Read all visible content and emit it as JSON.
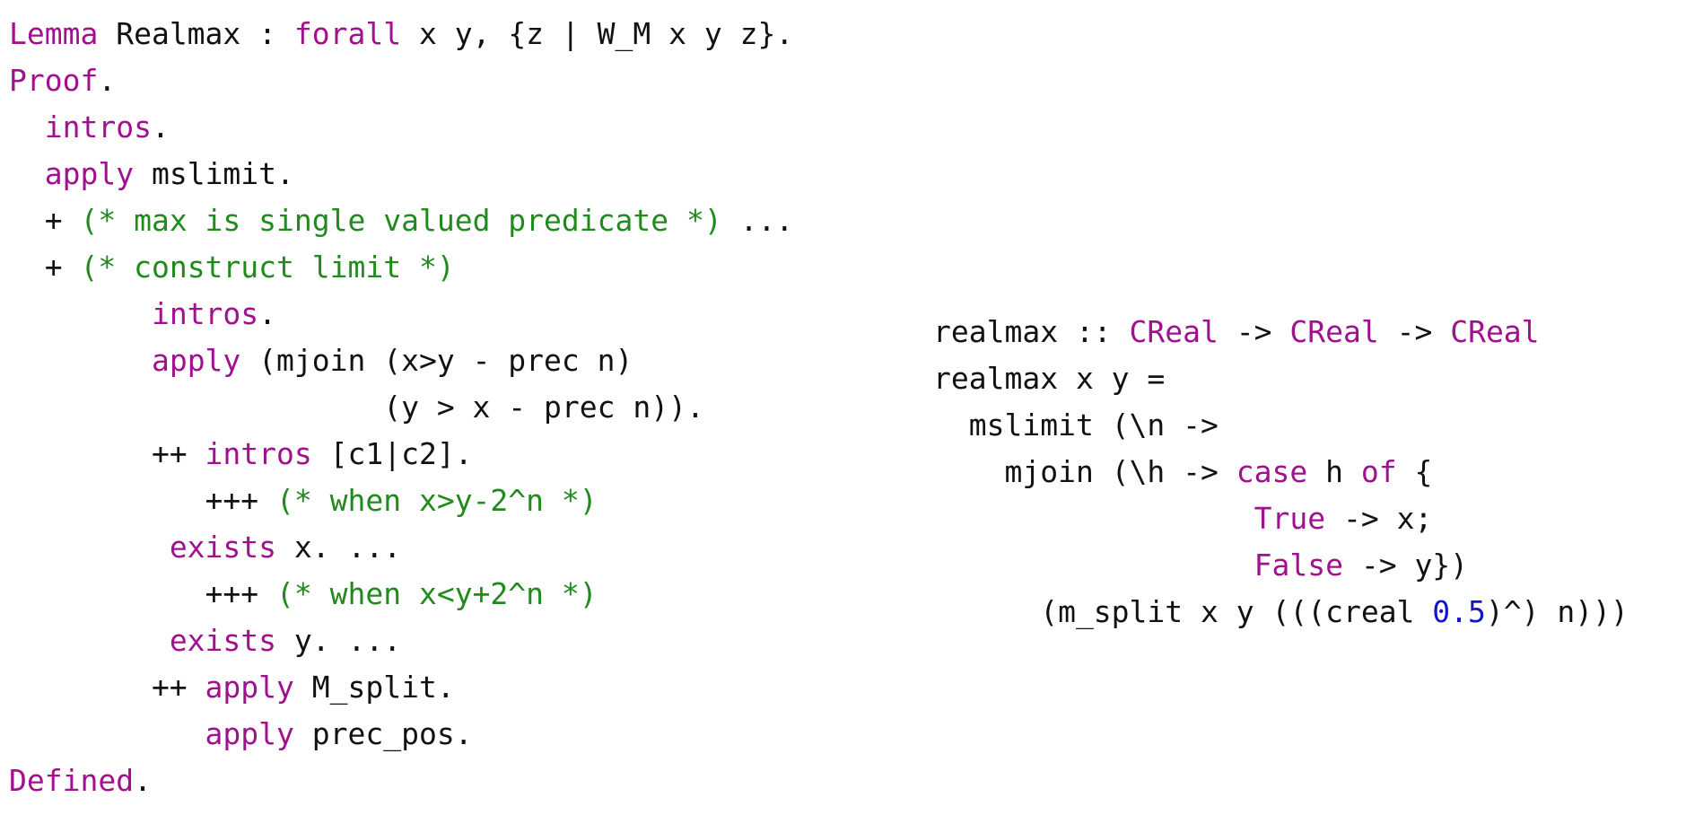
{
  "colors": {
    "keyword": "#a0108f",
    "comment": "#218a1d",
    "number": "#1515c8",
    "text": "#111111"
  },
  "coq": {
    "lines": [
      [
        [
          "kw",
          "Lemma"
        ],
        [
          "t",
          " Realmax : "
        ],
        [
          "kw",
          "forall"
        ],
        [
          "t",
          " x y, {z | W_M x y z}."
        ]
      ],
      [
        [
          "kw",
          "Proof"
        ],
        [
          "t",
          "."
        ]
      ],
      [
        [
          "t",
          "  "
        ],
        [
          "kw",
          "intros"
        ],
        [
          "t",
          "."
        ]
      ],
      [
        [
          "t",
          "  "
        ],
        [
          "kw",
          "apply"
        ],
        [
          "t",
          " mslimit."
        ]
      ],
      [
        [
          "t",
          "  + "
        ],
        [
          "cm",
          "(* max is single valued predicate *)"
        ],
        [
          "t",
          " ..."
        ]
      ],
      [
        [
          "t",
          "  + "
        ],
        [
          "cm",
          "(* construct limit *)"
        ]
      ],
      [
        [
          "t",
          "        "
        ],
        [
          "kw",
          "intros"
        ],
        [
          "t",
          "."
        ]
      ],
      [
        [
          "t",
          "        "
        ],
        [
          "kw",
          "apply"
        ],
        [
          "t",
          " (mjoin (x>y - prec n)"
        ]
      ],
      [
        [
          "t",
          "                     (y > x - prec n))."
        ]
      ],
      [
        [
          "t",
          "        ++ "
        ],
        [
          "kw",
          "intros"
        ],
        [
          "t",
          " [c1|c2]."
        ]
      ],
      [
        [
          "t",
          "           +++ "
        ],
        [
          "cm",
          "(* when x>y-2^n *)"
        ]
      ],
      [
        [
          "t",
          "         "
        ],
        [
          "kw",
          "exists"
        ],
        [
          "t",
          " x. ..."
        ]
      ],
      [
        [
          "t",
          "           +++ "
        ],
        [
          "cm",
          "(* when x<y+2^n *)"
        ]
      ],
      [
        [
          "t",
          "         "
        ],
        [
          "kw",
          "exists"
        ],
        [
          "t",
          " y. ..."
        ]
      ],
      [
        [
          "t",
          "        ++ "
        ],
        [
          "kw",
          "apply"
        ],
        [
          "t",
          " M_split."
        ]
      ],
      [
        [
          "t",
          "           "
        ],
        [
          "kw",
          "apply"
        ],
        [
          "t",
          " prec_pos."
        ]
      ],
      [
        [
          "kw",
          "Defined"
        ],
        [
          "t",
          "."
        ]
      ]
    ]
  },
  "haskell": {
    "lines": [
      [
        [
          "t",
          "realmax :: "
        ],
        [
          "kw",
          "CReal"
        ],
        [
          "t",
          " -> "
        ],
        [
          "kw",
          "CReal"
        ],
        [
          "t",
          " -> "
        ],
        [
          "kw",
          "CReal"
        ]
      ],
      [
        [
          "t",
          "realmax x y ="
        ]
      ],
      [
        [
          "t",
          "  mslimit (\\n ->"
        ]
      ],
      [
        [
          "t",
          "    mjoin (\\h -> "
        ],
        [
          "kw",
          "case"
        ],
        [
          "t",
          " h "
        ],
        [
          "kw",
          "of"
        ],
        [
          "t",
          " {"
        ]
      ],
      [
        [
          "t",
          "                  "
        ],
        [
          "kw",
          "True"
        ],
        [
          "t",
          " -> x;"
        ]
      ],
      [
        [
          "t",
          "                  "
        ],
        [
          "kw",
          "False"
        ],
        [
          "t",
          " -> y})"
        ]
      ],
      [
        [
          "t",
          "      (m_split x y (((creal "
        ],
        [
          "num",
          "0.5"
        ],
        [
          "t",
          ")^) n)))"
        ]
      ]
    ]
  }
}
